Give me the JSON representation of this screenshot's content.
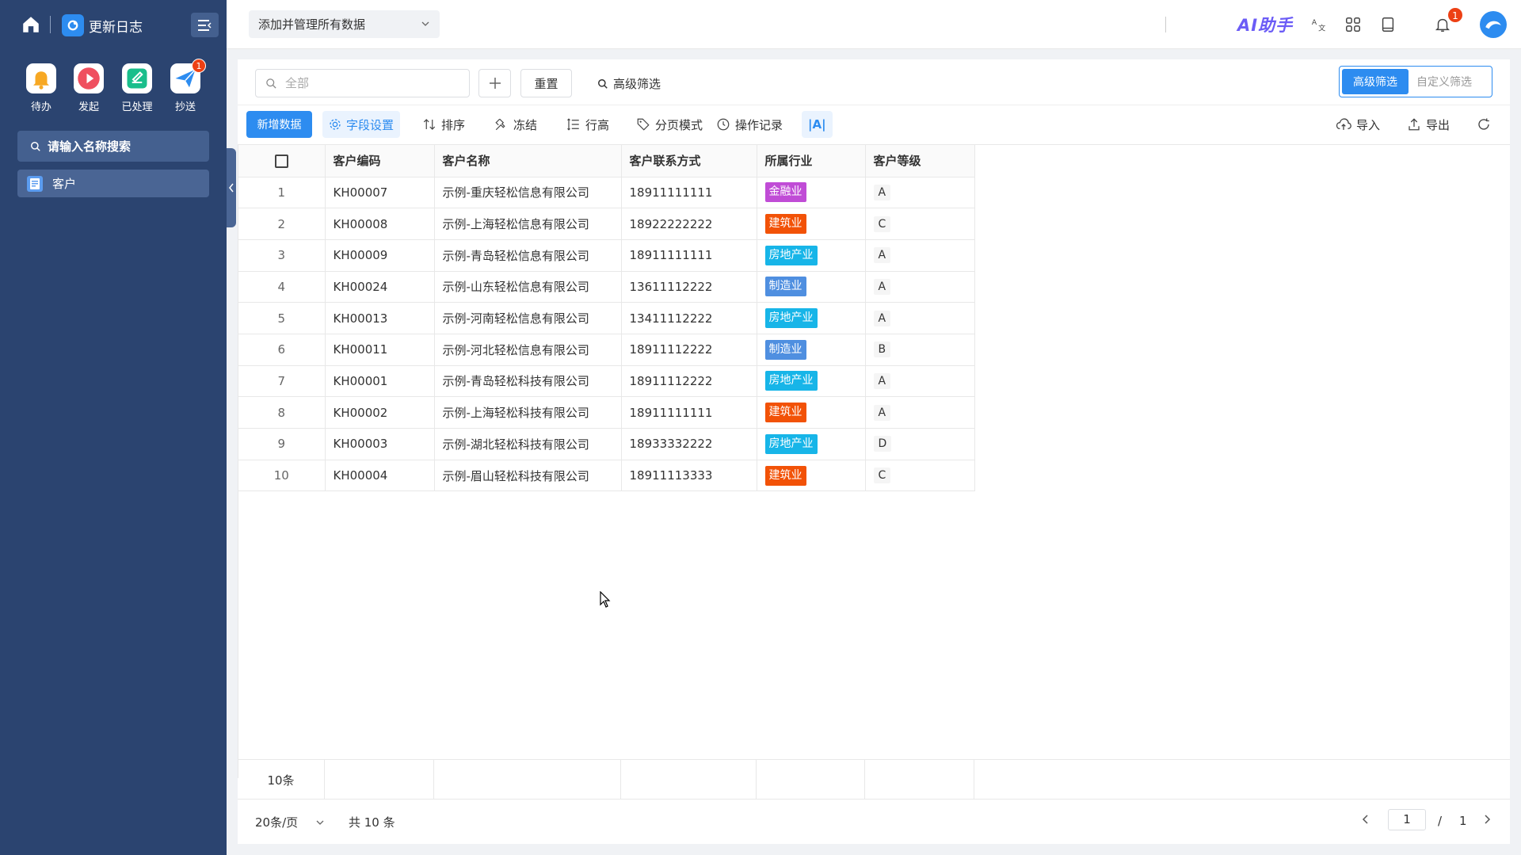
{
  "sidebar": {
    "changelog_label": "更新日志",
    "quick_actions": [
      {
        "label": "待办",
        "icon": "bell-icon",
        "color": "#f7a823"
      },
      {
        "label": "发起",
        "icon": "play-icon",
        "color": "#ef4f5f"
      },
      {
        "label": "已处理",
        "icon": "edit-icon",
        "color": "#19be8b"
      },
      {
        "label": "抄送",
        "icon": "send-icon",
        "color": "#2d8cf0",
        "badge": "1"
      }
    ],
    "search_placeholder": "请输入名称搜索",
    "items": [
      {
        "label": "客户",
        "icon": "document-icon"
      }
    ]
  },
  "header": {
    "app_select": "添加并管理所有数据",
    "ai_label": "AI助手",
    "bell_badge": "1"
  },
  "filter": {
    "search_placeholder": "全部",
    "reset_label": "重置",
    "advanced_label": "高级筛选",
    "segment_active": "高级筛选",
    "segment_other": "自定义筛选"
  },
  "toolbar": {
    "add_label": "新增数据",
    "field_settings": "字段设置",
    "sort": "排序",
    "freeze": "冻结",
    "row_height": "行高",
    "page_mode": "分页模式",
    "operation_log": "操作记录",
    "font_size": "|A|",
    "import": "导入",
    "export": "导出"
  },
  "table": {
    "columns": [
      "客户编码",
      "客户名称",
      "客户联系方式",
      "所属行业",
      "客户等级"
    ],
    "rows": [
      {
        "idx": "1",
        "code": "KH00007",
        "name": "示例-重庆轻松信息有限公司",
        "phone": "18911111111",
        "industry": "金融业",
        "industry_color": "#c04cd6",
        "grade": "A"
      },
      {
        "idx": "2",
        "code": "KH00008",
        "name": "示例-上海轻松信息有限公司",
        "phone": "18922222222",
        "industry": "建筑业",
        "industry_color": "#f25207",
        "grade": "C"
      },
      {
        "idx": "3",
        "code": "KH00009",
        "name": "示例-青岛轻松信息有限公司",
        "phone": "18911111111",
        "industry": "房地产业",
        "industry_color": "#17b5e8",
        "grade": "A"
      },
      {
        "idx": "4",
        "code": "KH00024",
        "name": "示例-山东轻松信息有限公司",
        "phone": "13611112222",
        "industry": "制造业",
        "industry_color": "#4f8fe0",
        "grade": "A"
      },
      {
        "idx": "5",
        "code": "KH00013",
        "name": "示例-河南轻松信息有限公司",
        "phone": "13411112222",
        "industry": "房地产业",
        "industry_color": "#17b5e8",
        "grade": "A"
      },
      {
        "idx": "6",
        "code": "KH00011",
        "name": "示例-河北轻松信息有限公司",
        "phone": "18911112222",
        "industry": "制造业",
        "industry_color": "#4f8fe0",
        "grade": "B"
      },
      {
        "idx": "7",
        "code": "KH00001",
        "name": "示例-青岛轻松科技有限公司",
        "phone": "18911112222",
        "industry": "房地产业",
        "industry_color": "#17b5e8",
        "grade": "A"
      },
      {
        "idx": "8",
        "code": "KH00002",
        "name": "示例-上海轻松科技有限公司",
        "phone": "18911111111",
        "industry": "建筑业",
        "industry_color": "#f25207",
        "grade": "A"
      },
      {
        "idx": "9",
        "code": "KH00003",
        "name": "示例-湖北轻松科技有限公司",
        "phone": "18933332222",
        "industry": "房地产业",
        "industry_color": "#17b5e8",
        "grade": "D"
      },
      {
        "idx": "10",
        "code": "KH00004",
        "name": "示例-眉山轻松科技有限公司",
        "phone": "18911113333",
        "industry": "建筑业",
        "industry_color": "#f25207",
        "grade": "C"
      }
    ],
    "summary_count": "10条"
  },
  "pagination": {
    "page_size": "20条/页",
    "total": "共 10 条",
    "current_page": "1",
    "slash": "/",
    "total_pages": "1"
  },
  "colors": {
    "sidebar_bg": "#2b4470",
    "primary": "#2d8cf0"
  }
}
